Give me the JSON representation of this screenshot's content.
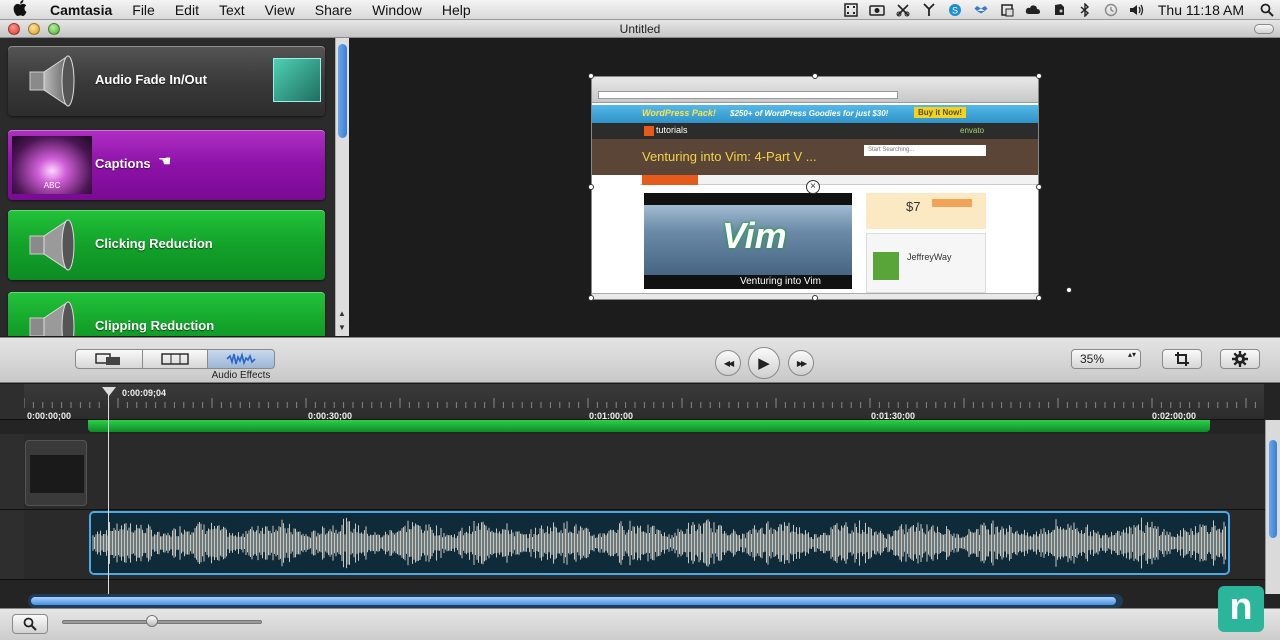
{
  "menubar": {
    "apple": "",
    "items": [
      "Camtasia",
      "File",
      "Edit",
      "Text",
      "View",
      "Share",
      "Window",
      "Help"
    ],
    "clock": "Thu 11:18 AM",
    "tray_icons": [
      "filmstrip-icon",
      "camera-icon",
      "scissors-icon",
      "antenna-icon",
      "skype-icon",
      "dropbox-icon",
      "crop-icon",
      "cloud-icon",
      "evernote-icon",
      "bluetooth-icon",
      "time-machine-icon",
      "volume-icon"
    ],
    "search_icon": "spotlight-search-icon"
  },
  "window": {
    "title": "Untitled"
  },
  "effects": [
    {
      "label": "Audio Fade In/Out",
      "color": "gray",
      "icon": "speaker-icon"
    },
    {
      "label": "Captions",
      "color": "purple",
      "icon": "captions-thumbnail",
      "thumb_text": "ABC"
    },
    {
      "label": "Clicking Reduction",
      "color": "green",
      "icon": "speaker-icon"
    },
    {
      "label": "Clipping Reduction",
      "color": "green",
      "icon": "speaker-icon"
    }
  ],
  "preview": {
    "banner_left": "WordPress Pack!",
    "banner_mid": "$250+ of WordPress Goodies for just $30!",
    "banner_btn": "Buy it Now!",
    "site_logo": "tutorials",
    "site_brand": "envato",
    "headline": "Venturing into Vim: 4-Part V ...",
    "search_placeholder": "Start Searching...",
    "price": "$7",
    "hero_caption": "Venturing into Vim",
    "hero_word": "Vim",
    "author": "JeffreyWay"
  },
  "toolbar": {
    "mode_label": "Audio Effects",
    "zoom": "35%",
    "zoom_arrows": "▴▾",
    "rewind": "◀◀",
    "play": "▶",
    "ffwd": "▶▶",
    "crop_icon": "crop-icon",
    "gear_icon": "gear-icon"
  },
  "timeline": {
    "playhead_time": "0:00:09;04",
    "ticks": [
      "0:00:00;00",
      "0:00:30;00",
      "0:01:00;00",
      "0:01:30;00",
      "0:02:00;00"
    ]
  },
  "bottombar": {
    "search_icon": "magnifier-icon"
  },
  "brand": {
    "letter": "n"
  },
  "colors": {
    "accent": "#3a7fd6",
    "purple": "#8d12a8",
    "green": "#13a22a",
    "waveform": "#c8c8c0"
  }
}
